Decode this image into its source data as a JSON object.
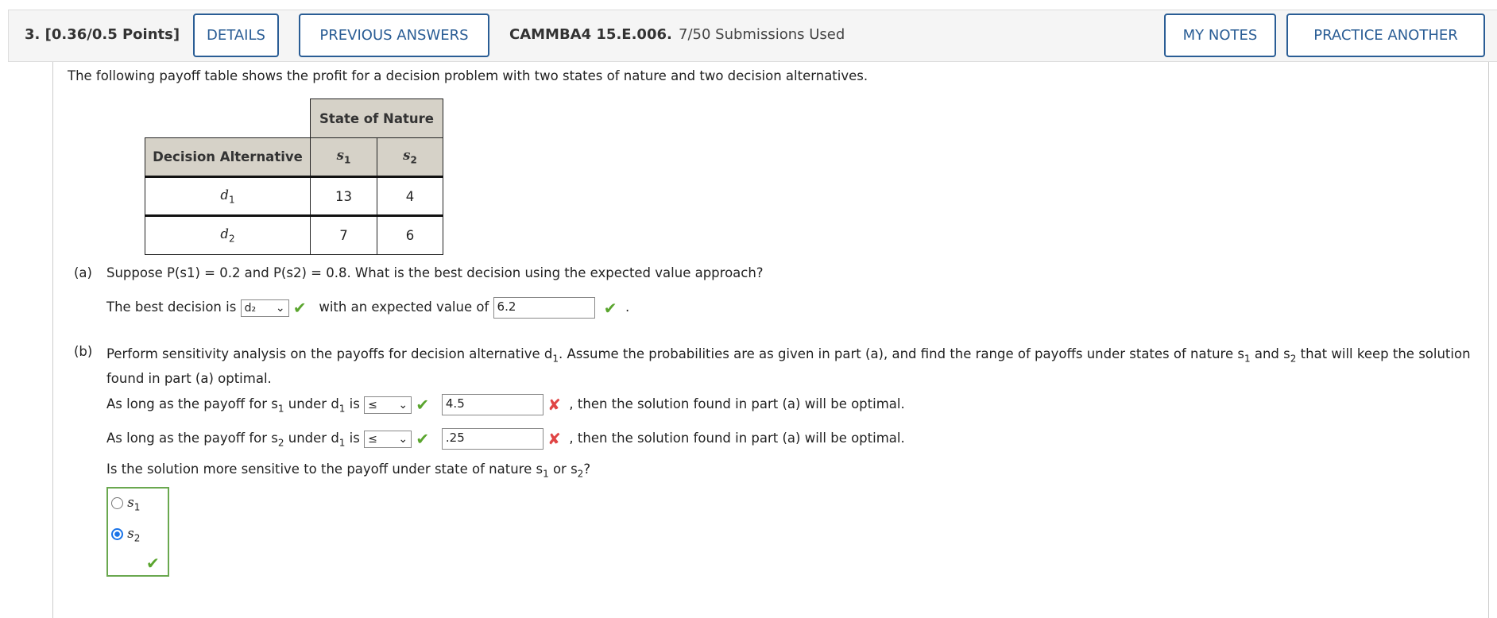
{
  "header": {
    "question": "3. [0.36/0.5 Points]",
    "details": "DETAILS",
    "previous_answers": "PREVIOUS ANSWERS",
    "code": "CAMMBA4 15.E.006.",
    "submissions": "7/50 Submissions Used",
    "my_notes": "MY NOTES",
    "practice_another": "PRACTICE ANOTHER"
  },
  "intro": "The following payoff table shows the profit for a decision problem with two states of nature and two decision alternatives.",
  "table": {
    "state_header": "State of Nature",
    "row_header": "Decision Alternative",
    "s1": "s",
    "s2": "s",
    "rows": [
      {
        "label": "d",
        "sub": "1",
        "s1": "13",
        "s2": "4"
      },
      {
        "label": "d",
        "sub": "2",
        "s1": "7",
        "s2": "6"
      }
    ]
  },
  "part_a": {
    "label": "(a)",
    "question": "Suppose P(s1) = 0.2 and P(s2) = 0.8. What is the best decision using the expected value approach?",
    "best_prefix": "The best decision is",
    "best_value": "d₂",
    "ev_prefix": "with an expected value of",
    "ev_value": "6.2"
  },
  "part_b": {
    "label": "(b)",
    "question_1": "Perform sensitivity analysis on the payoffs for decision alternative d",
    "question_2": ". Assume the probabilities are as given in part (a), and find the range of payoffs under states of nature s",
    "question_3": " and s",
    "question_4": " that will keep the solution",
    "question_5": "found in part (a) optimal.",
    "line_prefix": "As long as the payoff for s",
    "line_mid": " under d",
    "line_is": " is",
    "line_suffix": ", then the solution found in part (a) will be optimal.",
    "op1": "≤",
    "val1": "4.5",
    "op2": "≤",
    "val2": ".25",
    "sens_q1": "Is the solution more sensitive to the payoff under state of nature s",
    "sens_q2": " or s",
    "sens_q3": "?",
    "options": [
      "s",
      "s"
    ],
    "selected": 1
  },
  "colors": {
    "accent": "#2a5d95",
    "correct": "#5aa52e",
    "incorrect": "#e04545"
  }
}
